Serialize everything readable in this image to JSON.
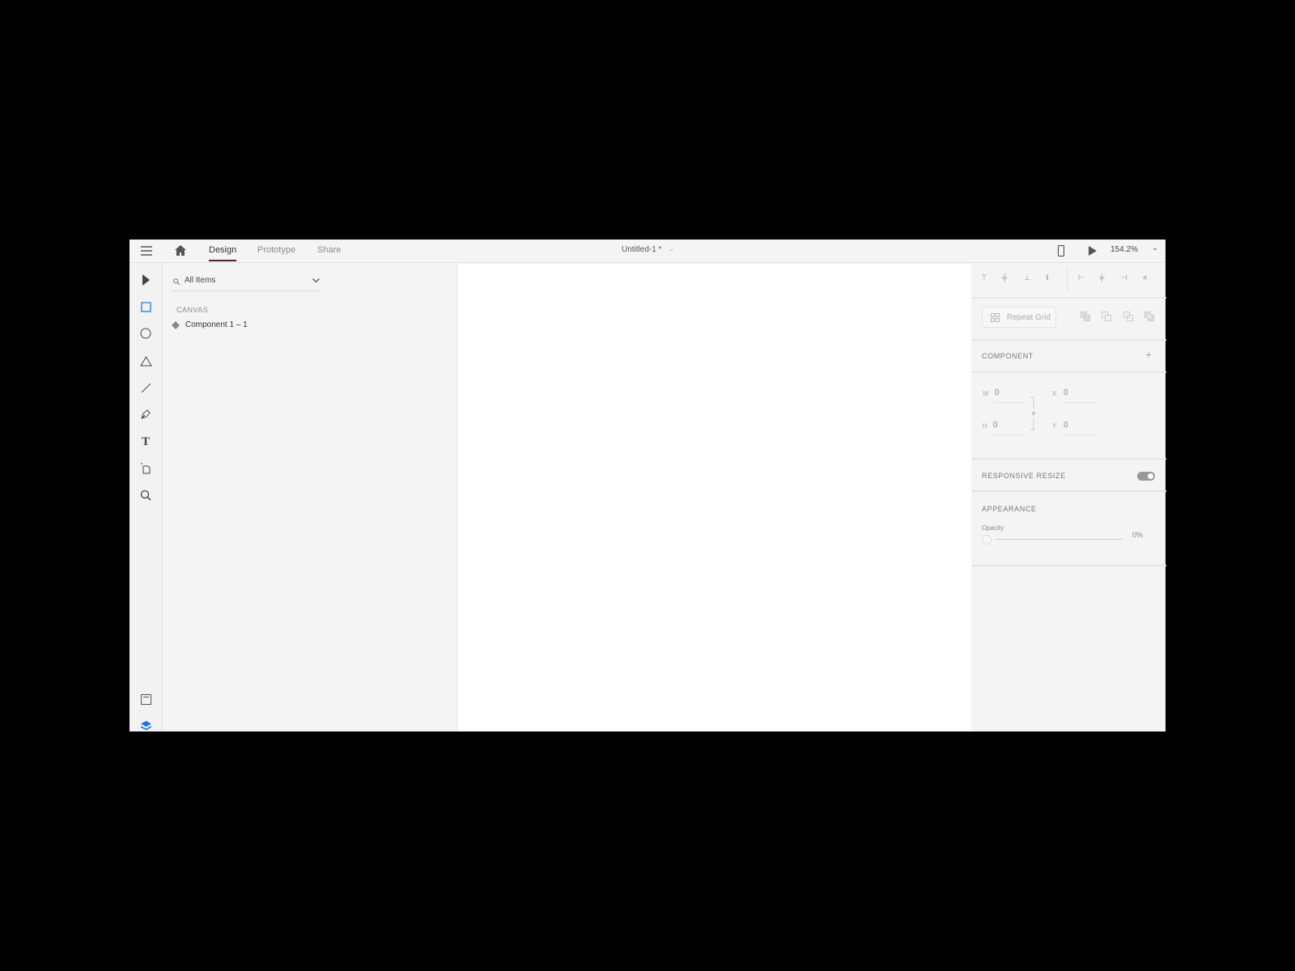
{
  "topbar": {
    "tabs": [
      {
        "label": "Design",
        "active": true
      },
      {
        "label": "Prototype"
      },
      {
        "label": "Share"
      }
    ],
    "title": "Untitled-1 *",
    "zoom": "154.2%"
  },
  "tools": [
    "select",
    "rectangle",
    "ellipse",
    "polygon",
    "line",
    "pen",
    "text",
    "artboard",
    "zoom"
  ],
  "layers": {
    "search_label": "All Items",
    "section": "CANVAS",
    "items": [
      {
        "label": "Component 1 – 1",
        "icon": "component-diamond-icon"
      }
    ]
  },
  "right": {
    "repeat_grid": "Repeat Grid",
    "component": "COMPONENT",
    "w_label": "W",
    "w": "0",
    "h_label": "H",
    "h": "0",
    "x_label": "X",
    "x": "0",
    "y_label": "Y",
    "y": "0",
    "responsive": "RESPONSIVE RESIZE",
    "responsive_on": true,
    "appearance": "APPEARANCE",
    "opacity_label": "Opacity",
    "opacity": "0%"
  },
  "colors": {
    "accent": "#1473e6",
    "tab_underline": "#5a1a3a"
  }
}
